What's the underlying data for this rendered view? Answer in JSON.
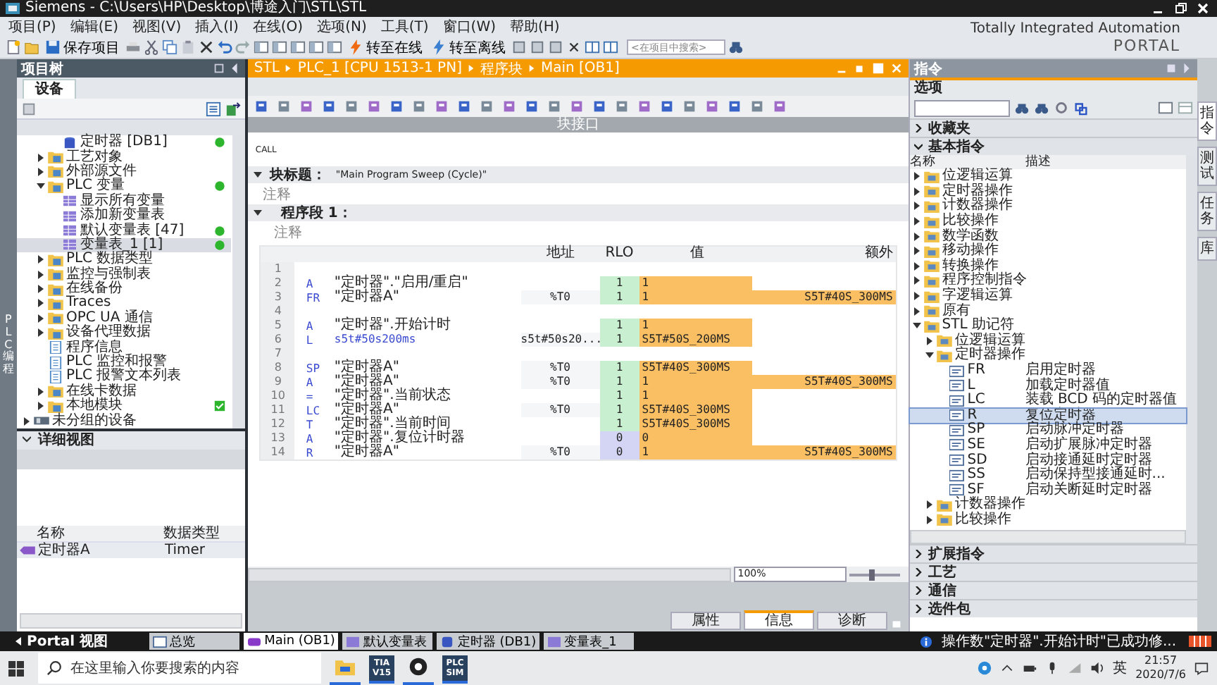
{
  "window": {
    "title": "Siemens  -  C:\\Users\\HP\\Desktop\\博途入门\\STL\\STL"
  },
  "menu": [
    "项目(P)",
    "编辑(E)",
    "视图(V)",
    "插入(I)",
    "在线(O)",
    "选项(N)",
    "工具(T)",
    "窗口(W)",
    "帮助(H)"
  ],
  "toolbar": {
    "save": "保存项目",
    "online": "转至在线",
    "offline": "转至离线",
    "search_placeholder": "<在项目中搜索>"
  },
  "brand": {
    "line1": "Totally Integrated Automation",
    "line2": "PORTAL"
  },
  "side_tab": "PLC 编程",
  "project_tree": {
    "title": "项目树",
    "tab": "设备",
    "items": [
      {
        "children": [
          {
            "children": [
              {
                "label": "定时器 [DB1]",
                "kind": "db",
                "online": true,
                "selected": false
              }
            ]
          },
          {
            "label": "工艺对象",
            "kind": "folder",
            "expanded": false,
            "selected": false
          },
          {
            "label": "外部源文件",
            "kind": "folder",
            "expanded": false,
            "selected": false
          },
          {
            "label": "PLC 变量",
            "kind": "folder",
            "expanded": true,
            "online": true,
            "selected": false,
            "children": [
              {
                "label": "显示所有变量",
                "kind": "table",
                "selected": false
              },
              {
                "label": "添加新变量表",
                "kind": "table",
                "selected": false
              },
              {
                "label": "默认变量表 [47]",
                "kind": "table",
                "online": true,
                "selected": false
              },
              {
                "label": "变量表_1 [1]",
                "kind": "table",
                "online": true,
                "selected": true
              }
            ]
          },
          {
            "label": "PLC 数据类型",
            "kind": "folder",
            "expanded": false,
            "selected": false
          },
          {
            "label": "监控与强制表",
            "kind": "folder",
            "expanded": false,
            "selected": false
          },
          {
            "label": "在线备份",
            "kind": "folder",
            "expanded": false,
            "selected": false
          },
          {
            "label": "Traces",
            "kind": "folder",
            "expanded": false,
            "selected": false
          },
          {
            "label": "OPC UA 通信",
            "kind": "folder",
            "expanded": false,
            "selected": false
          },
          {
            "label": "设备代理数据",
            "kind": "folder",
            "expanded": false,
            "selected": false
          },
          {
            "label": "程序信息",
            "kind": "item",
            "selected": false
          },
          {
            "label": "PLC 监控和报警",
            "kind": "item",
            "selected": false
          },
          {
            "label": "PLC 报警文本列表",
            "kind": "item",
            "selected": false
          },
          {
            "label": "在线卡数据",
            "kind": "folder",
            "expanded": false,
            "selected": false
          },
          {
            "label": "本地模块",
            "kind": "folder",
            "expanded": false,
            "verified": true,
            "selected": false
          }
        ]
      },
      {
        "label": "未分组的设备",
        "kind": "device",
        "expanded": false,
        "selected": false
      }
    ]
  },
  "details": {
    "title": "详细视图",
    "columns": [
      "名称",
      "数据类型"
    ],
    "rows": [
      {
        "name": "定时器A",
        "type": "Timer"
      }
    ]
  },
  "editor": {
    "breadcrumb": [
      "STL",
      "PLC_1 [CPU 1513-1 PN]",
      "程序块",
      "Main [OB1]"
    ],
    "interface_bar": "块接口",
    "palette": "CALL",
    "block_title_label": "块标题：",
    "block_title": "\"Main Program Sweep (Cycle)\"",
    "block_comment": "注释",
    "network_label": "程序段 1：",
    "network_comment": "注释",
    "columns": [
      "地址",
      "RLO",
      "值",
      "额外"
    ],
    "rows": [
      {
        "num": "1"
      },
      {
        "num": "2",
        "op": "A",
        "operand": "\"定时器\".\"启用/重启\"",
        "constant": false,
        "rlo": "1",
        "rlo_high": true,
        "value": "1"
      },
      {
        "num": "3",
        "op": "FR",
        "operand": "\"定时器A\"",
        "constant": false,
        "address": "%T0",
        "rlo": "1",
        "rlo_high": true,
        "value": "1",
        "extra": "S5T#40S_300MS"
      },
      {
        "num": "4"
      },
      {
        "num": "5",
        "op": "A",
        "operand": "\"定时器\".开始计时",
        "constant": false,
        "rlo": "1",
        "rlo_high": true,
        "value": "1"
      },
      {
        "num": "6",
        "op": "L",
        "operand": "s5t#50s200ms",
        "constant": true,
        "address": "s5t#50s20...",
        "rlo": "1",
        "rlo_high": true,
        "value": "S5T#50S_200MS"
      },
      {
        "num": "7"
      },
      {
        "num": "8",
        "op": "SP",
        "operand": "\"定时器A\"",
        "constant": false,
        "address": "%T0",
        "rlo": "1",
        "rlo_high": true,
        "value": "S5T#40S_300MS"
      },
      {
        "num": "9",
        "op": "A",
        "operand": "\"定时器A\"",
        "constant": false,
        "address": "%T0",
        "rlo": "1",
        "rlo_high": true,
        "value": "1",
        "extra": "S5T#40S_300MS"
      },
      {
        "num": "10",
        "op": "=",
        "operand": "\"定时器\".当前状态",
        "constant": false,
        "rlo": "1",
        "rlo_high": true,
        "value": "1"
      },
      {
        "num": "11",
        "op": "LC",
        "operand": "\"定时器A\"",
        "constant": false,
        "address": "%T0",
        "rlo": "1",
        "rlo_high": true,
        "value": "S5T#40S_300MS"
      },
      {
        "num": "12",
        "op": "T",
        "operand": "\"定时器\".当前时间",
        "constant": false,
        "rlo": "1",
        "rlo_high": true,
        "value": "S5T#40S_300MS"
      },
      {
        "num": "13",
        "op": "A",
        "operand": "\"定时器\".复位计时器",
        "constant": false,
        "rlo": "0",
        "rlo_high": false,
        "value": "0"
      },
      {
        "num": "14",
        "op": "R",
        "operand": "\"定时器A\"",
        "constant": false,
        "address": "%T0",
        "rlo": "0",
        "rlo_high": false,
        "value": "1",
        "extra": "S5T#40S_300MS"
      }
    ],
    "zoom": "100%",
    "zoom_slider": {
      "level": 0.45
    }
  },
  "inspector_tabs": [
    {
      "label": "属性",
      "selected": false
    },
    {
      "label": "信息",
      "selected": true
    },
    {
      "label": "诊断",
      "selected": false
    }
  ],
  "instructions": {
    "title": "指令",
    "options": "选项",
    "sections": [
      {
        "label": "收藏夹",
        "expanded": false
      },
      {
        "label": "基本指令",
        "expanded": true,
        "columns": [
          "名称",
          "描述"
        ],
        "items": [
          {
            "label": "位逻辑运算",
            "kind": "folder",
            "expanded": false,
            "selected": false
          },
          {
            "label": "定时器操作",
            "kind": "folder",
            "expanded": false,
            "selected": false
          },
          {
            "label": "计数器操作",
            "kind": "folder",
            "expanded": false,
            "selected": false
          },
          {
            "label": "比较操作",
            "kind": "folder",
            "expanded": false,
            "selected": false
          },
          {
            "label": "数学函数",
            "kind": "folder",
            "expanded": false,
            "selected": false
          },
          {
            "label": "移动操作",
            "kind": "folder",
            "expanded": false,
            "selected": false
          },
          {
            "label": "转换操作",
            "kind": "folder",
            "expanded": false,
            "selected": false
          },
          {
            "label": "程序控制指令",
            "kind": "folder",
            "expanded": false,
            "selected": false
          },
          {
            "label": "字逻辑运算",
            "kind": "folder",
            "expanded": false,
            "selected": false
          },
          {
            "label": "原有",
            "kind": "folder",
            "expanded": false,
            "selected": false
          },
          {
            "label": "STL 助记符",
            "kind": "folder",
            "expanded": true,
            "selected": false,
            "children": [
              {
                "label": "位逻辑运算",
                "kind": "folder",
                "expanded": false,
                "selected": false
              },
              {
                "label": "定时器操作",
                "kind": "folder",
                "expanded": true,
                "selected": false,
                "children": [
                  {
                    "label": "FR",
                    "description": "启用定时器",
                    "kind": "instruction",
                    "selected": false
                  },
                  {
                    "label": "L",
                    "description": "加载定时器值",
                    "kind": "instruction",
                    "selected": false
                  },
                  {
                    "label": "LC",
                    "description": "装载 BCD 码的定时器值",
                    "kind": "instruction",
                    "selected": false
                  },
                  {
                    "label": "R",
                    "description": "复位定时器",
                    "kind": "instruction",
                    "selected": true
                  },
                  {
                    "label": "SP",
                    "description": "启动脉冲定时器",
                    "kind": "instruction",
                    "selected": false
                  },
                  {
                    "label": "SE",
                    "description": "启动扩展脉冲定时器",
                    "kind": "instruction",
                    "selected": false
                  },
                  {
                    "label": "SD",
                    "description": "启动接通延时定时器",
                    "kind": "instruction",
                    "selected": false
                  },
                  {
                    "label": "SS",
                    "description": "启动保持型接通延时...",
                    "kind": "instruction",
                    "selected": false
                  },
                  {
                    "label": "SF",
                    "description": "启动关断延时定时器",
                    "kind": "instruction",
                    "selected": false
                  }
                ]
              },
              {
                "label": "计数器操作",
                "kind": "folder",
                "expanded": false,
                "selected": false
              },
              {
                "label": "比较操作",
                "kind": "folder",
                "expanded": false,
                "selected": false
              }
            ]
          }
        ]
      },
      {
        "label": "扩展指令",
        "expanded": false
      },
      {
        "label": "工艺",
        "expanded": false
      },
      {
        "label": "通信",
        "expanded": false
      },
      {
        "label": "选件包",
        "expanded": false
      }
    ]
  },
  "side_tabs": [
    {
      "label": "指令",
      "selected": true
    },
    {
      "label": "测试",
      "selected": false
    },
    {
      "label": "任务",
      "selected": false
    },
    {
      "label": "库",
      "selected": false
    }
  ],
  "portal_bar": {
    "portal": "Portal 视图",
    "tabs": [
      {
        "label": "总览",
        "kind": "overview",
        "selected": false
      },
      {
        "label": "Main (OB1)",
        "kind": "block",
        "selected": true
      },
      {
        "label": "默认变量表",
        "kind": "table",
        "selected": false
      },
      {
        "label": "定时器 (DB1)",
        "kind": "db",
        "selected": false
      },
      {
        "label": "变量表_1",
        "kind": "table",
        "selected": false
      }
    ],
    "message": "操作数\"定时器\".开始计时\"已成功修..."
  },
  "taskbar": {
    "search_placeholder": "在这里输入你要搜索的内容",
    "apps": [
      {
        "kind": "folder"
      },
      {
        "kind": "tia",
        "label": "TIA V15"
      },
      {
        "kind": "recorder"
      },
      {
        "kind": "plcsim",
        "label": "PLC SIM"
      }
    ],
    "ime": "英",
    "time": "21:57",
    "date": "2020/7/6"
  }
}
